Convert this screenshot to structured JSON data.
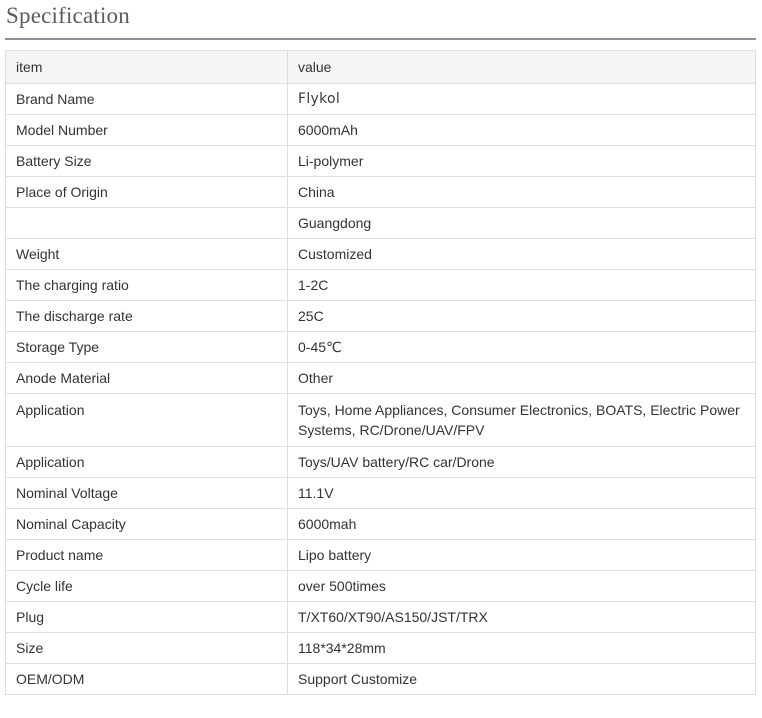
{
  "heading": "Specification",
  "table": {
    "header": {
      "item": "item",
      "value": "value"
    },
    "rows": [
      {
        "item": "Brand Name",
        "value": "Flykol"
      },
      {
        "item": "Model Number",
        "value": "6000mAh"
      },
      {
        "item": "Battery Size",
        "value": "Li-polymer"
      },
      {
        "item": "Place of Origin",
        "value": "China"
      },
      {
        "item": "",
        "value": "Guangdong"
      },
      {
        "item": "Weight",
        "value": "Customized"
      },
      {
        "item": "The charging ratio",
        "value": "1-2C"
      },
      {
        "item": "The discharge rate",
        "value": "25C"
      },
      {
        "item": "Storage Type",
        "value": "0-45℃"
      },
      {
        "item": "Anode Material",
        "value": "Other"
      },
      {
        "item": "Application",
        "value": "Toys, Home Appliances, Consumer Electronics, BOATS, Electric Power Systems, RC/Drone/UAV/FPV"
      },
      {
        "item": "Application",
        "value": "Toys/UAV battery/RC car/Drone"
      },
      {
        "item": "Nominal Voltage",
        "value": "11.1V"
      },
      {
        "item": "Nominal Capacity",
        "value": "6000mah"
      },
      {
        "item": "Product name",
        "value": "Lipo battery"
      },
      {
        "item": "Cycle life",
        "value": "over 500times"
      },
      {
        "item": "Plug",
        "value": "T/XT60/XT90/AS150/JST/TRX"
      },
      {
        "item": "Size",
        "value": "118*34*28mm"
      },
      {
        "item": "OEM/ODM",
        "value": "Support Customize"
      }
    ]
  }
}
